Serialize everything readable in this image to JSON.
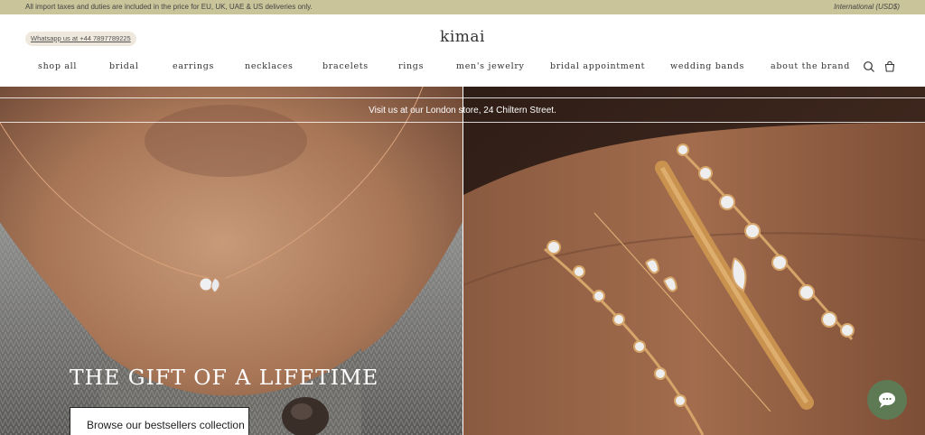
{
  "announcement": {
    "left": "All import taxes and duties are included in the price for EU, UK, UAE & US deliveries only.",
    "right": "International (USD$)"
  },
  "header": {
    "whatsapp": "Whatsapp us at +44 7897789225",
    "logo": "kimai",
    "nav": [
      "shop all",
      "bridal",
      "earrings",
      "necklaces",
      "bracelets",
      "rings",
      "men's jewelry",
      "bridal appointment",
      "wedding bands",
      "about the brand"
    ],
    "icons": [
      "search-icon",
      "bag-icon"
    ]
  },
  "hero": {
    "store_notice": "Visit us at our London store, 24 Chiltern Street.",
    "headline": "THE GIFT OF A LIFETIME",
    "cta": "Browse our bestsellers collection"
  },
  "chat": {
    "icon": "chat-bubble-icon",
    "color": "#5e7a54"
  },
  "colors": {
    "announcement_bg": "#c9c49a",
    "pill_bg": "#efe9dd"
  }
}
